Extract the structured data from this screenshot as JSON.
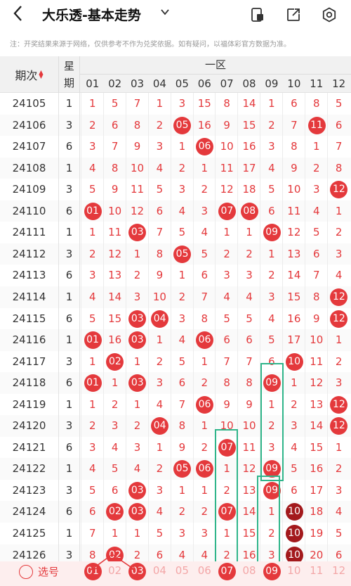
{
  "header": {
    "back_icon": "chevron-left",
    "title": "大乐透-基本走势",
    "title_caret": "chevron-down",
    "icons": [
      "phone-screen-icon",
      "share-icon",
      "settings-icon"
    ]
  },
  "notice": "注：开奖结果来源于网络，仅供参考不作为兑奖依据。如有疑问，以福体彩官方数据为准。",
  "table_header": {
    "issue_label": "期次",
    "week_label_1": "星",
    "week_label_2": "期",
    "zone_label": "一区",
    "columns": [
      "01",
      "02",
      "03",
      "04",
      "05",
      "06",
      "07",
      "08",
      "09",
      "10",
      "11",
      "12"
    ]
  },
  "rows": [
    {
      "issue": "24105",
      "week": "1",
      "cells": [
        "1",
        "5",
        "7",
        "1",
        "3",
        "15",
        "8",
        "14",
        "1",
        "6",
        "8",
        "5"
      ],
      "balls": []
    },
    {
      "issue": "24106",
      "week": "3",
      "cells": [
        "2",
        "6",
        "8",
        "2",
        "05",
        "16",
        "9",
        "15",
        "2",
        "7",
        "11",
        "6"
      ],
      "balls": [
        4,
        10
      ]
    },
    {
      "issue": "24107",
      "week": "6",
      "cells": [
        "3",
        "7",
        "9",
        "3",
        "1",
        "06",
        "10",
        "16",
        "3",
        "8",
        "1",
        "7"
      ],
      "balls": [
        5
      ]
    },
    {
      "issue": "24108",
      "week": "1",
      "cells": [
        "4",
        "8",
        "10",
        "4",
        "2",
        "1",
        "11",
        "17",
        "4",
        "9",
        "2",
        "8"
      ],
      "balls": []
    },
    {
      "issue": "24109",
      "week": "3",
      "cells": [
        "5",
        "9",
        "11",
        "5",
        "3",
        "2",
        "12",
        "18",
        "5",
        "10",
        "3",
        "12"
      ],
      "balls": [
        11
      ]
    },
    {
      "issue": "24110",
      "week": "6",
      "cells": [
        "01",
        "10",
        "12",
        "6",
        "4",
        "3",
        "07",
        "08",
        "6",
        "11",
        "4",
        "1"
      ],
      "balls": [
        0,
        6,
        7
      ]
    },
    {
      "issue": "24111",
      "week": "1",
      "cells": [
        "1",
        "11",
        "03",
        "7",
        "5",
        "4",
        "1",
        "1",
        "09",
        "12",
        "5",
        "2"
      ],
      "balls": [
        2,
        8
      ]
    },
    {
      "issue": "24112",
      "week": "3",
      "cells": [
        "2",
        "12",
        "1",
        "8",
        "05",
        "5",
        "2",
        "2",
        "1",
        "13",
        "6",
        "3"
      ],
      "balls": [
        4
      ]
    },
    {
      "issue": "24113",
      "week": "6",
      "cells": [
        "3",
        "13",
        "2",
        "9",
        "1",
        "6",
        "3",
        "3",
        "2",
        "14",
        "7",
        "4"
      ],
      "balls": []
    },
    {
      "issue": "24114",
      "week": "1",
      "cells": [
        "4",
        "14",
        "3",
        "10",
        "2",
        "7",
        "4",
        "4",
        "3",
        "15",
        "8",
        "12"
      ],
      "balls": [
        11
      ]
    },
    {
      "issue": "24115",
      "week": "6",
      "cells": [
        "5",
        "15",
        "03",
        "04",
        "3",
        "8",
        "5",
        "5",
        "4",
        "16",
        "9",
        "12"
      ],
      "balls": [
        2,
        3,
        11
      ]
    },
    {
      "issue": "24116",
      "week": "1",
      "cells": [
        "01",
        "16",
        "03",
        "1",
        "4",
        "06",
        "6",
        "6",
        "5",
        "17",
        "10",
        "1"
      ],
      "balls": [
        0,
        2,
        5
      ]
    },
    {
      "issue": "24117",
      "week": "3",
      "cells": [
        "1",
        "02",
        "1",
        "2",
        "5",
        "1",
        "7",
        "7",
        "6",
        "10",
        "11",
        "2"
      ],
      "balls": [
        1,
        9
      ]
    },
    {
      "issue": "24118",
      "week": "6",
      "cells": [
        "01",
        "1",
        "03",
        "3",
        "6",
        "2",
        "8",
        "8",
        "09",
        "1",
        "12",
        "3"
      ],
      "balls": [
        0,
        2,
        8
      ]
    },
    {
      "issue": "24119",
      "week": "1",
      "cells": [
        "1",
        "2",
        "1",
        "4",
        "7",
        "06",
        "9",
        "9",
        "1",
        "2",
        "13",
        "12"
      ],
      "balls": [
        5,
        11
      ]
    },
    {
      "issue": "24120",
      "week": "3",
      "cells": [
        "2",
        "3",
        "2",
        "04",
        "8",
        "1",
        "10",
        "10",
        "2",
        "3",
        "14",
        "12"
      ],
      "balls": [
        3,
        11
      ]
    },
    {
      "issue": "24121",
      "week": "6",
      "cells": [
        "3",
        "4",
        "3",
        "1",
        "9",
        "2",
        "07",
        "11",
        "3",
        "4",
        "15",
        "1"
      ],
      "balls": [
        6
      ]
    },
    {
      "issue": "24122",
      "week": "1",
      "cells": [
        "4",
        "5",
        "4",
        "2",
        "05",
        "06",
        "1",
        "12",
        "09",
        "5",
        "16",
        "2"
      ],
      "balls": [
        4,
        5,
        8
      ]
    },
    {
      "issue": "24123",
      "week": "3",
      "cells": [
        "5",
        "6",
        "03",
        "3",
        "1",
        "1",
        "2",
        "13",
        "09",
        "6",
        "17",
        "3"
      ],
      "balls": [
        2,
        8
      ]
    },
    {
      "issue": "24124",
      "week": "6",
      "cells": [
        "6",
        "02",
        "03",
        "4",
        "2",
        "2",
        "07",
        "14",
        "1",
        "10",
        "18",
        "4"
      ],
      "balls": [
        1,
        2,
        6,
        9
      ]
    },
    {
      "issue": "24125",
      "week": "1",
      "cells": [
        "7",
        "1",
        "1",
        "5",
        "3",
        "3",
        "1",
        "15",
        "2",
        "10",
        "19",
        "5"
      ],
      "balls": [
        9
      ]
    },
    {
      "issue": "24126",
      "week": "3",
      "cells": [
        "8",
        "02",
        "2",
        "6",
        "4",
        "4",
        "2",
        "16",
        "3",
        "10",
        "20",
        "6"
      ],
      "balls": [
        1,
        9
      ]
    }
  ],
  "dark_balls": [
    [
      19,
      9
    ],
    [
      20,
      9
    ],
    [
      21,
      9
    ]
  ],
  "bottom_bar": {
    "select_label": "选号",
    "numbers": [
      "01",
      "02",
      "03",
      "04",
      "05",
      "06",
      "07",
      "08",
      "09",
      "10",
      "11",
      "12"
    ],
    "selected": [
      0,
      2,
      6,
      8
    ]
  },
  "colors": {
    "accent": "#e4393c",
    "highlight_box": "#2fb58a",
    "dark_ball": "#a3191c"
  }
}
